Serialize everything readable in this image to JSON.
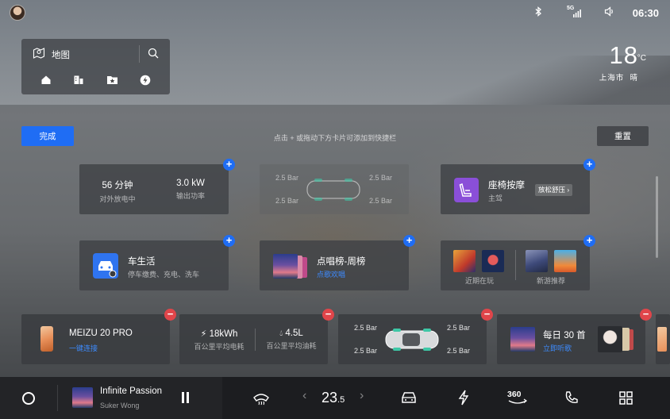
{
  "status_bar": {
    "time": "06:30",
    "signal_label": "5G",
    "icons": [
      "bluetooth-icon",
      "signal-5g-icon",
      "volume-icon"
    ]
  },
  "map_widget": {
    "label": "地图",
    "shortcuts": [
      "home-icon",
      "office-icon",
      "favorites-icon",
      "charging-icon"
    ]
  },
  "weather": {
    "temperature": "18",
    "unit": "°C",
    "city": "上海市",
    "condition": "晴"
  },
  "edit_bar": {
    "done_label": "完成",
    "hint": "点击 + 或拖动下方卡片可添加到快捷栏",
    "reset_label": "重置"
  },
  "available_cards": {
    "discharge": {
      "duration_value": "56 分钟",
      "duration_label": "对外放电中",
      "power_value": "3.0 kW",
      "power_label": "输出功率"
    },
    "tire_pressure": {
      "fl": "2.5 Bar",
      "fr": "2.5 Bar",
      "rl": "2.5 Bar",
      "rr": "2.5 Bar"
    },
    "seat_massage": {
      "title": "座椅按摩",
      "subtitle": "主驾",
      "mode_button": "放松舒压"
    },
    "car_life": {
      "title": "车生活",
      "subtitle": "停车缴费、充电、洗车"
    },
    "chart": {
      "title": "点唱榜-周榜",
      "action": "点歌欢唱"
    },
    "games": {
      "recent_label": "近期在玩",
      "new_label": "新游推荐"
    }
  },
  "quick_cards": {
    "phone": {
      "title": "MEIZU 20 PRO",
      "action": "一键连接"
    },
    "energy": {
      "electric_value": "18kWh",
      "electric_label": "百公里平均电耗",
      "fuel_value": "4.5L",
      "fuel_label": "百公里平均油耗"
    },
    "tire_pressure": {
      "fl": "2.5 Bar",
      "fr": "2.5 Bar",
      "rl": "2.5 Bar",
      "rr": "2.5 Bar"
    },
    "daily": {
      "title": "每日 30 首",
      "action": "立即听歌"
    }
  },
  "dock": {
    "track_title": "Infinite Passion",
    "artist": "Suker Wong",
    "temperature_int": "23",
    "temperature_dec": ".5",
    "view_360": "360",
    "icons": [
      "home-circle-icon",
      "pause-icon",
      "defrost-icon",
      "chevron-left-icon",
      "chevron-right-icon",
      "car-icon",
      "lightning-icon",
      "view-360-icon",
      "phone-icon",
      "apps-grid-icon"
    ]
  },
  "colors": {
    "accent": "#1f6df4",
    "remove": "#e0454a",
    "link": "#3d8bff"
  }
}
